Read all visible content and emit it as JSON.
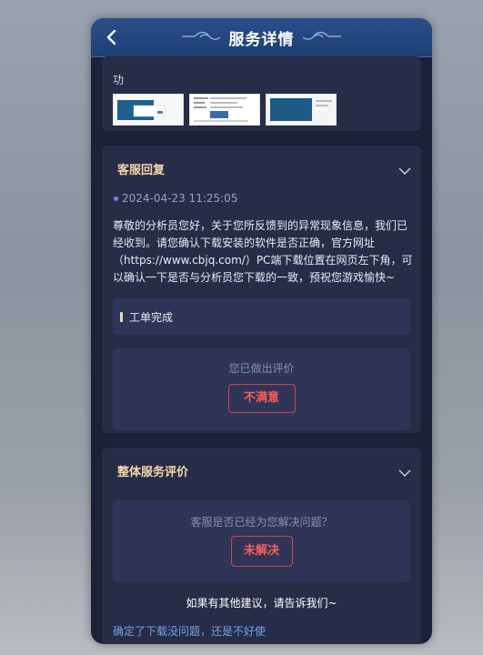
{
  "header": {
    "title": "服务详情",
    "back_icon": "chevron-left-icon"
  },
  "attachments_card": {
    "text": "功",
    "thumbnails": [
      "screenshot-thumbnail",
      "screenshot-thumbnail",
      "screenshot-thumbnail"
    ]
  },
  "reply_card": {
    "title": "客服回复",
    "timestamp": "2024-04-23 11:25:05",
    "message": "尊敬的分析员您好，关于您所反馈到的异常现象信息，我们已经收到。请您确认下载安装的软件是否正确，官方网址（https://www.cbjq.com/）PC端下载位置在网页左下角，可以确认一下是否与分析员您下载的一致，预祝您游戏愉快~",
    "status": "工单完成",
    "evaluation_caption": "您已做出评价",
    "rating": "不满意"
  },
  "overall_card": {
    "title": "整体服务评价",
    "question": "客服是否已经为您解决问题？",
    "answer": "未解决",
    "suggestion_label": "如果有其他建议，请告诉我们~",
    "suggestion_text": "确定了下载没问题，还是不好使"
  },
  "colors": {
    "header_bg": "#234784",
    "panel_bg": "#272c47",
    "accent_gold": "#f3d9a8",
    "badge_red": "#ff5a5a",
    "link_blue": "#6fa3e6"
  }
}
